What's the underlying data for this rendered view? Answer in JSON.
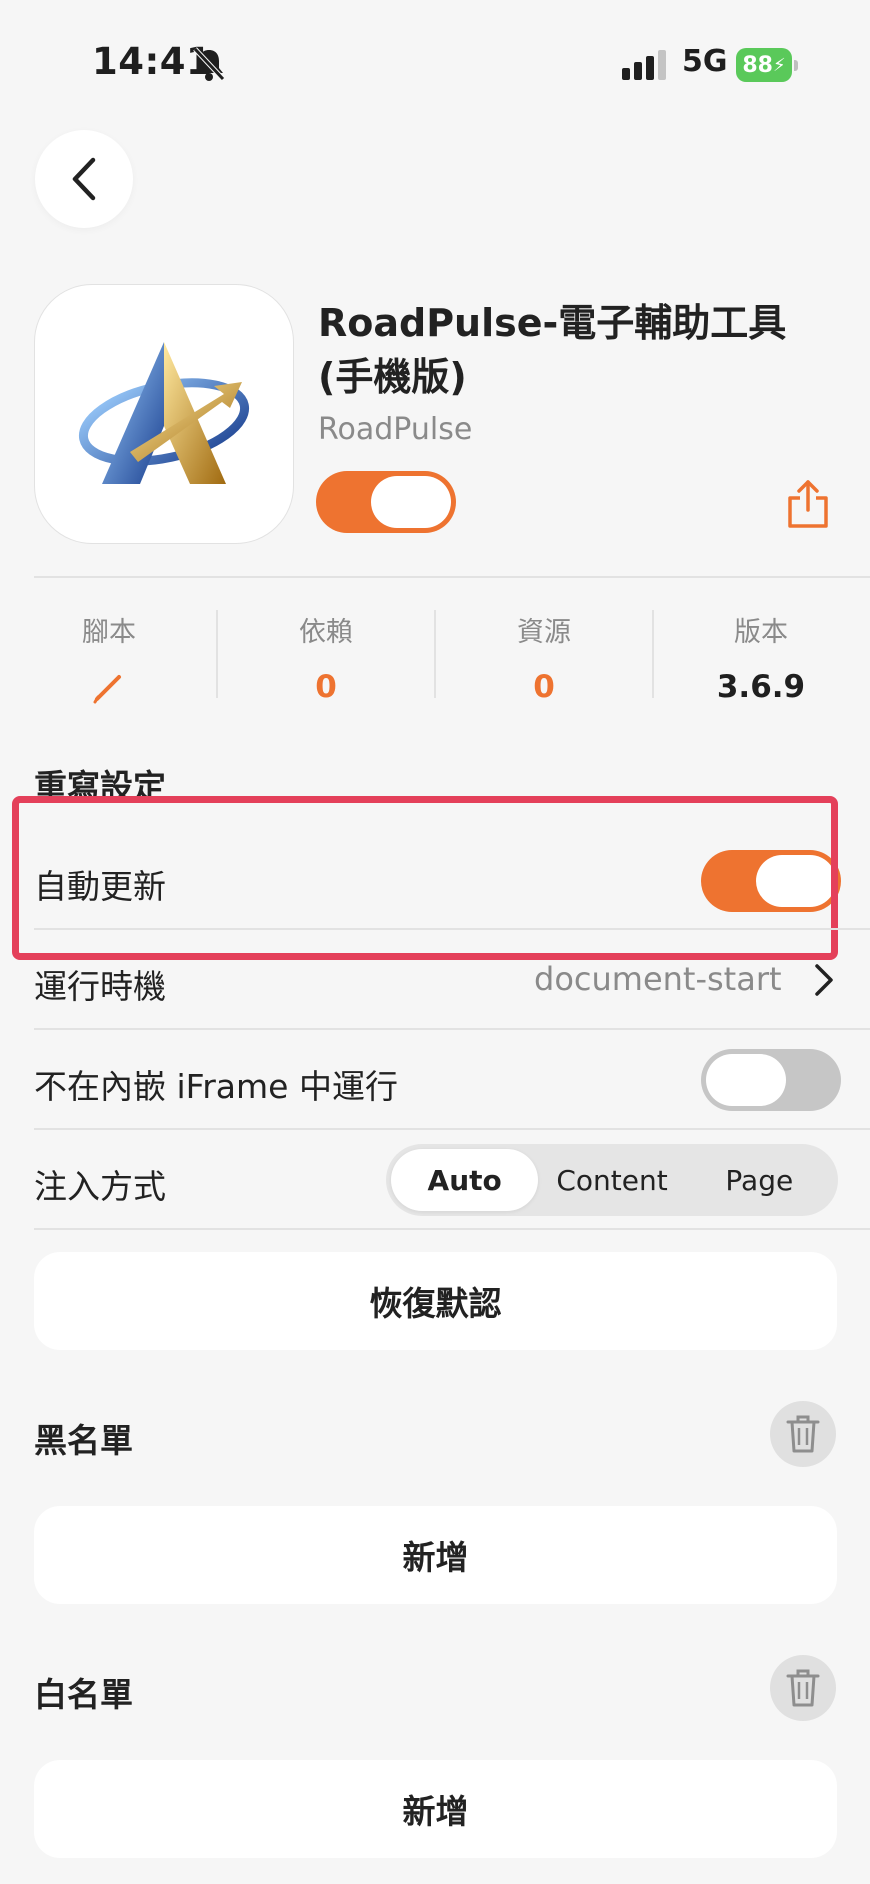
{
  "status_bar": {
    "time": "14:41",
    "network": "5G",
    "battery": "88"
  },
  "app": {
    "title": "RoadPulse-電子輔助工具(手機版)",
    "author": "RoadPulse",
    "enabled": true
  },
  "stats": [
    {
      "label": "腳本",
      "value": "",
      "icon": "pencil-icon"
    },
    {
      "label": "依賴",
      "value": "0"
    },
    {
      "label": "資源",
      "value": "0"
    },
    {
      "label": "版本",
      "value": "3.6.9"
    }
  ],
  "settings": {
    "section_title": "重寫設定",
    "auto_update": {
      "label": "自動更新",
      "on": true
    },
    "run_at": {
      "label": "運行時機",
      "value": "document-start"
    },
    "no_iframe": {
      "label": "不在內嵌 iFrame 中運行",
      "on": false
    },
    "inject": {
      "label": "注入方式",
      "options": [
        "Auto",
        "Content",
        "Page"
      ],
      "selected": "Auto"
    },
    "restore_label": "恢復默認"
  },
  "blacklist": {
    "title": "黑名單",
    "add_label": "新增"
  },
  "whitelist": {
    "title": "白名單",
    "add_label": "新增"
  },
  "colors": {
    "accent": "#ee7330",
    "highlight": "#e4405a",
    "battery": "#5ac95a"
  }
}
